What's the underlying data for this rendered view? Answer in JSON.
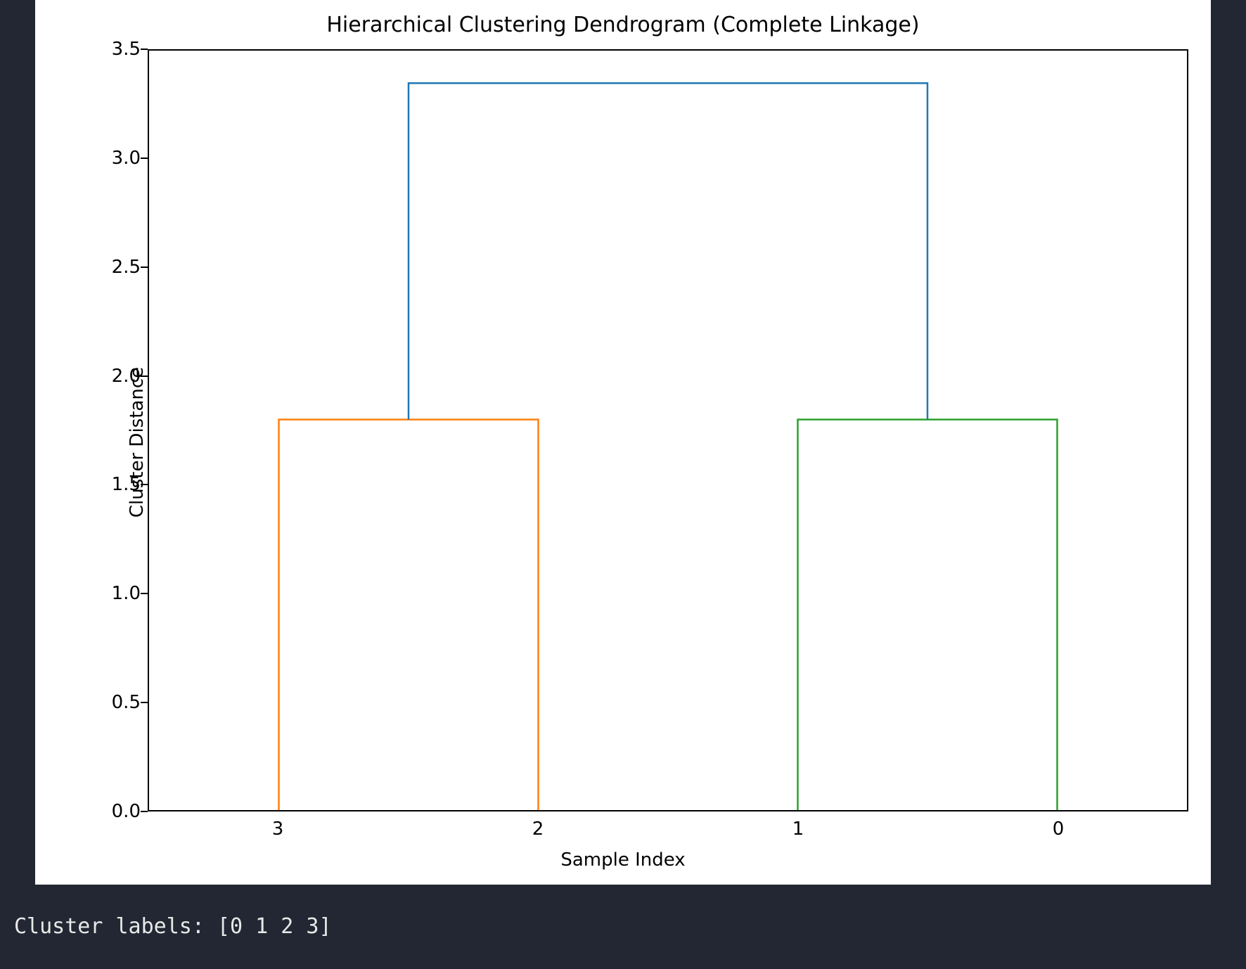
{
  "chart_data": {
    "type": "dendrogram",
    "title": "Hierarchical Clustering Dendrogram (Complete Linkage)",
    "xlabel": "Sample Index",
    "ylabel": "Cluster Distance",
    "ylim": [
      0.0,
      3.5
    ],
    "yticks": [
      0.0,
      0.5,
      1.0,
      1.5,
      2.0,
      2.5,
      3.0,
      3.5
    ],
    "leaf_order": [
      "3",
      "2",
      "1",
      "0"
    ],
    "leaf_positions": [
      5,
      15,
      25,
      35
    ],
    "x_range": [
      0,
      40
    ],
    "links": [
      {
        "left_x": 5,
        "right_x": 15,
        "left_y": 0.0,
        "right_y": 0.0,
        "height": 1.8,
        "color": "#ff7f0e"
      },
      {
        "left_x": 25,
        "right_x": 35,
        "left_y": 0.0,
        "right_y": 0.0,
        "height": 1.8,
        "color": "#2ca02c"
      },
      {
        "left_x": 10,
        "right_x": 30,
        "left_y": 1.8,
        "right_y": 1.8,
        "height": 3.35,
        "color": "#1f77b4"
      }
    ]
  },
  "console_line": "Cluster labels: [0 1 2 3]"
}
